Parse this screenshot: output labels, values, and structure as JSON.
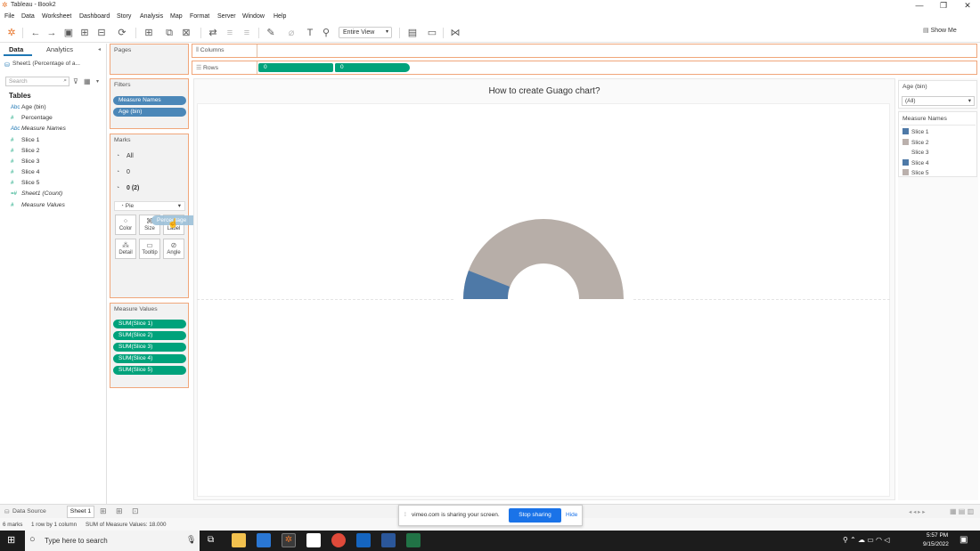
{
  "window": {
    "title": "Tableau - Book2",
    "controls": [
      "—",
      "❐",
      "✕"
    ]
  },
  "menu": [
    "File",
    "Data",
    "Worksheet",
    "Dashboard",
    "Story",
    "Analysis",
    "Map",
    "Format",
    "Server",
    "Window",
    "Help"
  ],
  "toolbar": {
    "view_select": "Entire View",
    "show_me": "Show Me"
  },
  "datapane": {
    "tab_data": "Data",
    "tab_analytics": "Analytics",
    "datasource": "Sheet1 (Percentage of a...",
    "search_placeholder": "Search",
    "tables_heading": "Tables",
    "fields": [
      {
        "icon": "Abc",
        "name": "Age (bin)",
        "kind": "dim"
      },
      {
        "icon": "#",
        "name": "Percentage",
        "kind": "dim"
      },
      {
        "icon": "Abc",
        "name": "Measure Names",
        "kind": "dim"
      },
      {
        "icon": "#",
        "name": "Slice 1",
        "kind": "mea"
      },
      {
        "icon": "#",
        "name": "Slice 2",
        "kind": "mea"
      },
      {
        "icon": "#",
        "name": "Slice 3",
        "kind": "mea"
      },
      {
        "icon": "#",
        "name": "Slice 4",
        "kind": "mea"
      },
      {
        "icon": "#",
        "name": "Slice 5",
        "kind": "mea"
      },
      {
        "icon": "=#",
        "name": "Sheet1 (Count)",
        "kind": "mea"
      },
      {
        "icon": "#",
        "name": "Measure Values",
        "kind": "mea"
      }
    ]
  },
  "pages": {
    "heading": "Pages"
  },
  "filters": {
    "heading": "Filters",
    "pills": [
      "Measure Names",
      "Age (bin)"
    ]
  },
  "marks": {
    "heading": "Marks",
    "rows": [
      "All",
      "0",
      "0 (2)"
    ],
    "mark_type": "Pie",
    "buttons": [
      "Color",
      "Size",
      "Label",
      "Detail",
      "Tooltip",
      "Angle"
    ],
    "drag_pill": "Percentage"
  },
  "measure_values": {
    "heading": "Measure Values",
    "pills": [
      "SUM(Slice 1)",
      "SUM(Slice 2)",
      "SUM(Slice 3)",
      "SUM(Slice 4)",
      "SUM(Slice 5)"
    ]
  },
  "shelves": {
    "columns_label": "Columns",
    "rows_label": "Rows",
    "rows_pills": [
      "0",
      "0"
    ]
  },
  "view": {
    "title": "How to create Guago chart?"
  },
  "age_filter": {
    "heading": "Age (bin)",
    "value": "(All)"
  },
  "legend": {
    "heading": "Measure Names",
    "items": [
      {
        "name": "Slice 1",
        "color": "#4e79a7"
      },
      {
        "name": "Slice 2",
        "color": "#bab0ac"
      },
      {
        "name": "Slice 3",
        "color": "#ffffff"
      },
      {
        "name": "Slice 4",
        "color": "#4e79a7"
      },
      {
        "name": "Slice 5",
        "color": "#bab0ac"
      }
    ]
  },
  "bottom_tabs": {
    "data_source": "Data Source",
    "sheet1": "Sheet 1"
  },
  "status": {
    "marks": "6 marks",
    "dims": "1 row by 1 column",
    "sum": "SUM of Measure Values: 18.000"
  },
  "vimeo": {
    "text": "vimeo.com is sharing your screen.",
    "stop": "Stop sharing",
    "hide": "Hide"
  },
  "taskbar": {
    "search": "Type here to search",
    "time": "5:57 PM",
    "date": "9/15/2022"
  }
}
